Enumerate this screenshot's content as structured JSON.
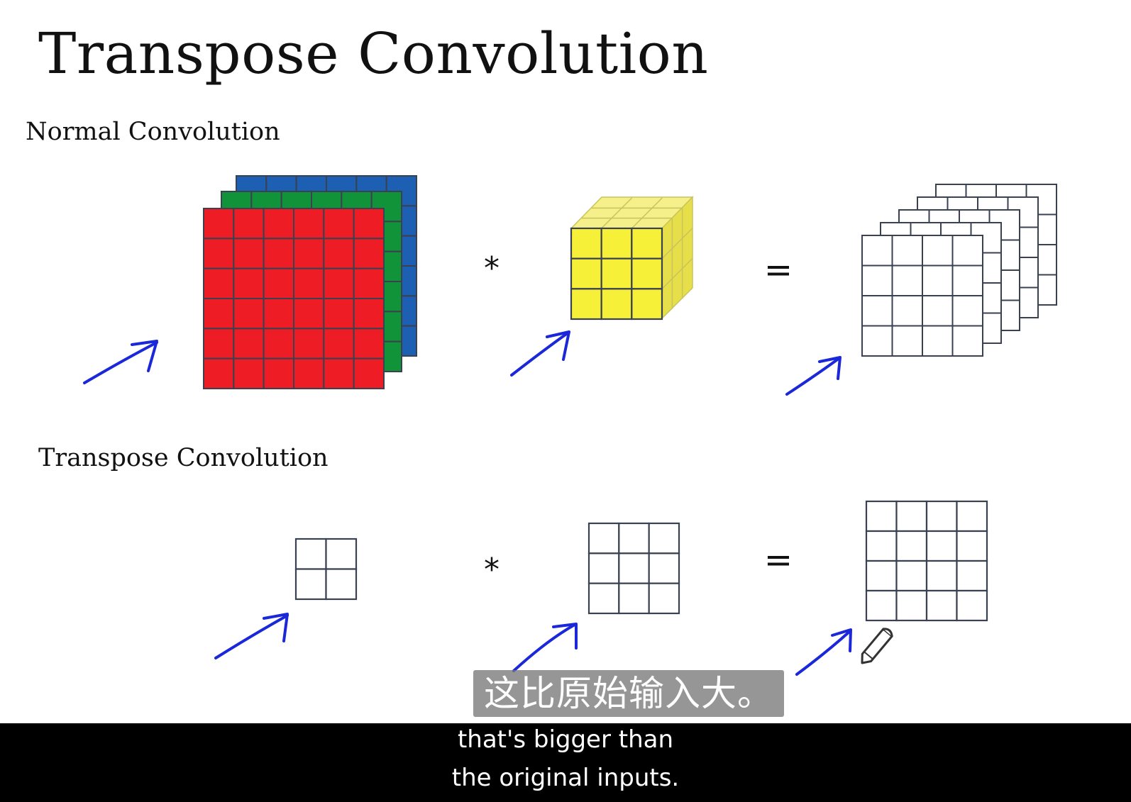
{
  "slide": {
    "title": "Transpose Convolution",
    "section_normal": "Normal Convolution",
    "section_transpose": "Transpose Convolution"
  },
  "diagram": {
    "normal_row": {
      "input_grid": 6,
      "input_layer_colors": [
        "#1c5fb3",
        "#119339",
        "#ee1c24"
      ],
      "operator_star": "*",
      "filter_grid": 3,
      "filter_color": "#f7f038",
      "operator_equals": "=",
      "output_grid": 4,
      "output_layers": 5
    },
    "transpose_row": {
      "input_grid": 2,
      "operator_star": "*",
      "filter_grid": 3,
      "operator_equals": "=",
      "output_grid": 4
    },
    "annotation_color": "#1a28d9",
    "grid_line_color": "#3a4150"
  },
  "subtitles": {
    "chinese": "这比原始输入大。",
    "english_line1": "that's bigger than",
    "english_line2": "the original inputs."
  }
}
